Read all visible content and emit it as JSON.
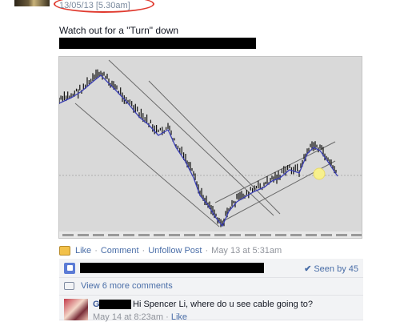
{
  "post": {
    "timestamp": "13/05/13 [5.30am]",
    "text": "Watch out for a \"Turn\" down"
  },
  "chart": {
    "background": "#d9d9d9",
    "price_line_color": "#3b3fb5",
    "bar_color": "#111111",
    "highlight_color": "#f7f08c"
  },
  "actions": {
    "like": "Like",
    "comment": "Comment",
    "unfollow": "Unfollow Post",
    "time": "May 13 at 5:31am",
    "sep": "·"
  },
  "ufi": {
    "seen": "Seen by 45",
    "view_more": "View 6 more comments"
  },
  "comment": {
    "author_initial": "G",
    "text": "Hi Spencer Li, where do u see cable going to?",
    "time": "May 14 at 8:23am",
    "like": "Like",
    "sep": "·"
  }
}
